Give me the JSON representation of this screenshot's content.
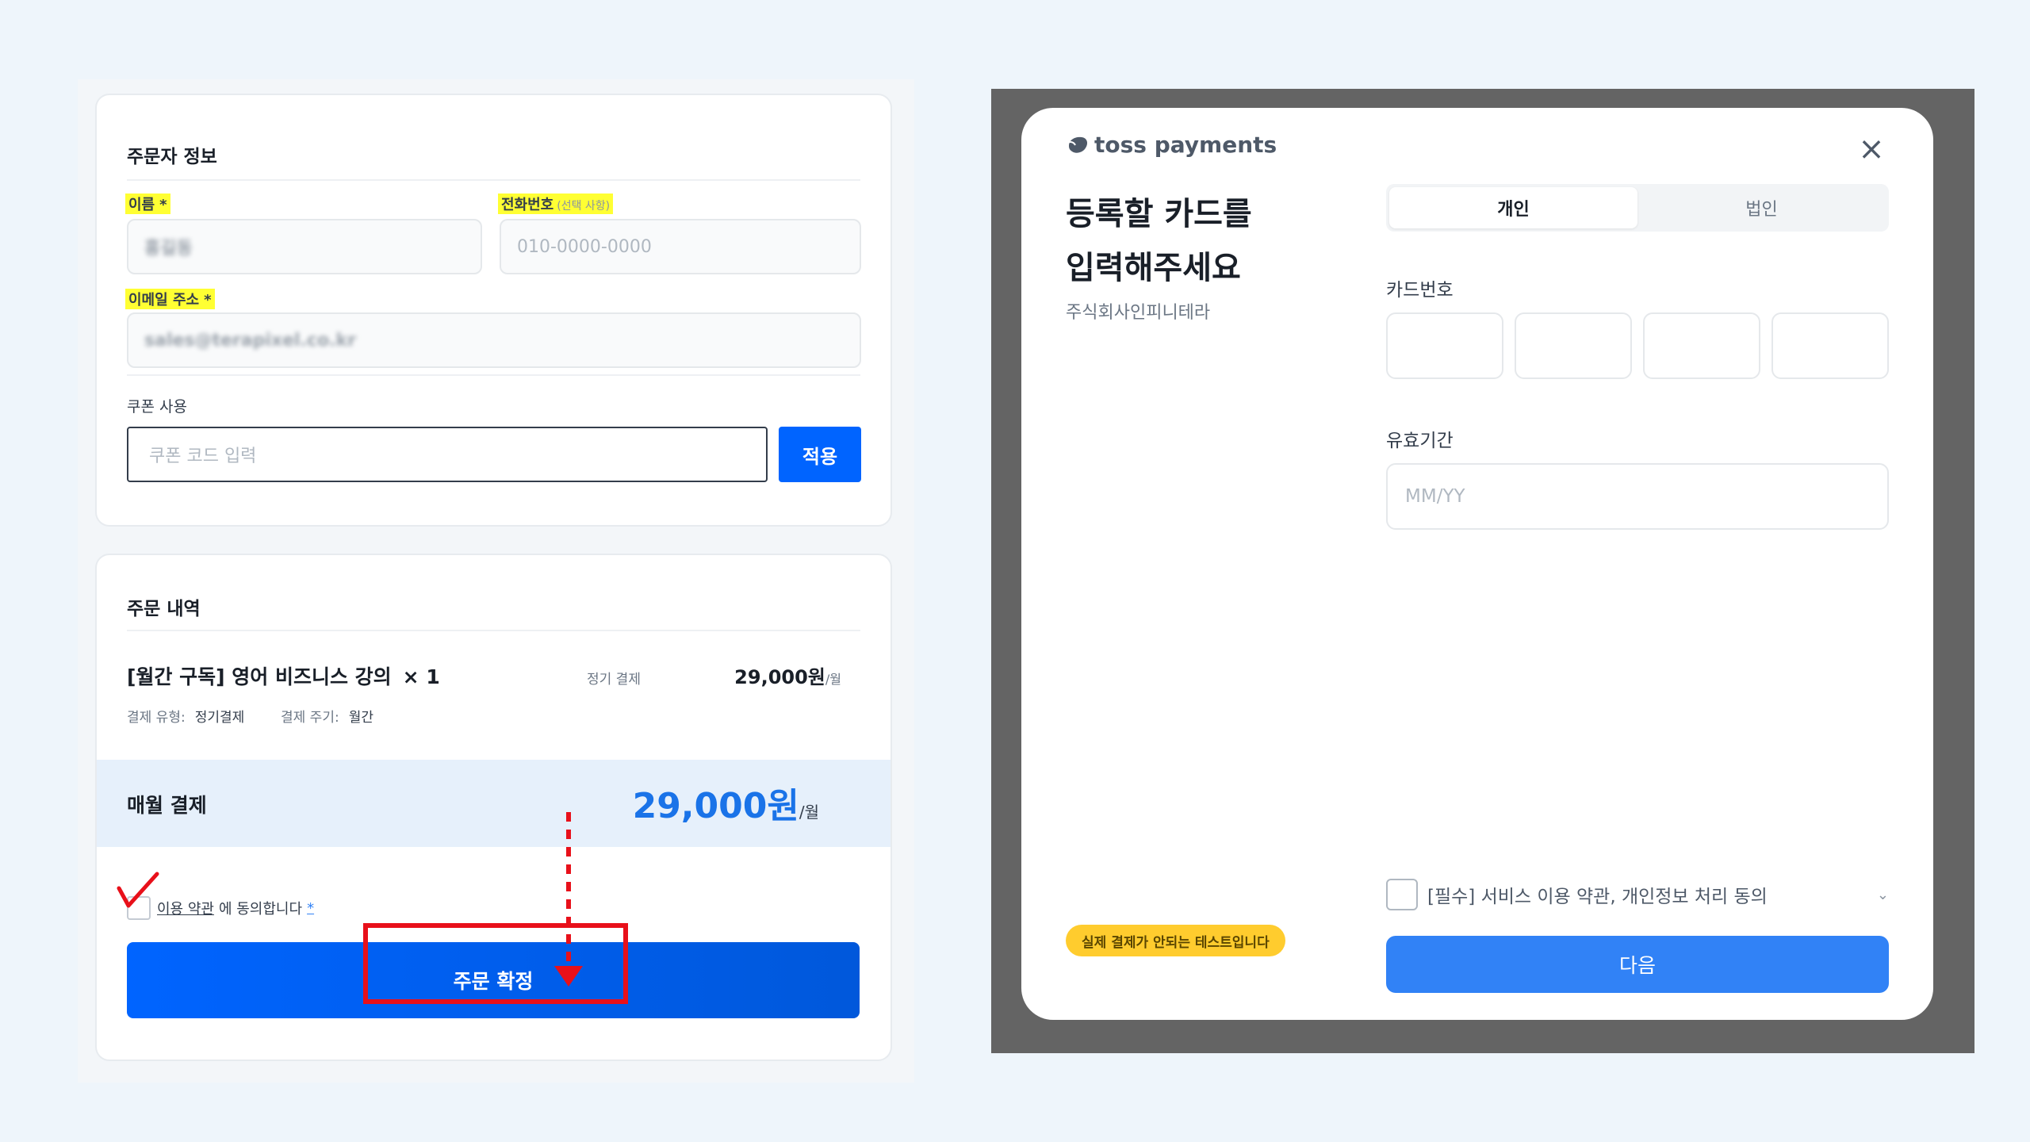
{
  "left": {
    "info": {
      "title": "주문자 정보",
      "name_label": "이름",
      "required_mark": "*",
      "name_value": "홍길동",
      "phone_label": "전화번호",
      "phone_optional": "(선택 사항)",
      "phone_placeholder": "010-0000-0000",
      "email_label": "이메일 주소",
      "email_value": "sales@terapixel.co.kr",
      "coupon_label": "쿠폰 사용",
      "coupon_placeholder": "쿠폰 코드 입력",
      "apply_label": "적용"
    },
    "order": {
      "title": "주문 내역",
      "product_name": "[월간 구독] 영어 비즈니스 강의",
      "product_qty": "× 1",
      "billing_tag": "정기 결제",
      "price": "29,000원",
      "per_month": "/월",
      "pay_type_label": "결제 유형:",
      "pay_type_value": "정기결제",
      "cycle_label": "결제 주기:",
      "cycle_value": "월간",
      "monthly_label": "매월 결제",
      "monthly_price": "29,000원",
      "terms_link": "이용 약관",
      "agree_text": "에 동의합니다",
      "agree_mark": "*",
      "confirm_label": "주문 확정"
    },
    "colors": {
      "primary": "#0064ff",
      "highlight": "#e8101a",
      "marker": "#ffff33"
    }
  },
  "modal": {
    "brand": "toss payments",
    "close_icon": "close-icon",
    "title_line1": "등록할 카드를",
    "title_line2": "입력해주세요",
    "merchant": "주식회사인피니테라",
    "tab_personal": "개인",
    "tab_corporate": "법인",
    "card_number_label": "카드번호",
    "expiry_label": "유효기간",
    "expiry_placeholder": "MM/YY",
    "consent_text": "[필수] 서비스 이용 약관, 개인정보 처리 동의",
    "chevron": "⌄",
    "next_label": "다음",
    "test_badge": "실제 결제가 안되는 테스트입니다",
    "colors": {
      "next_button": "#3182f6",
      "badge": "#ffcc2e",
      "backdrop": "#646464"
    }
  }
}
